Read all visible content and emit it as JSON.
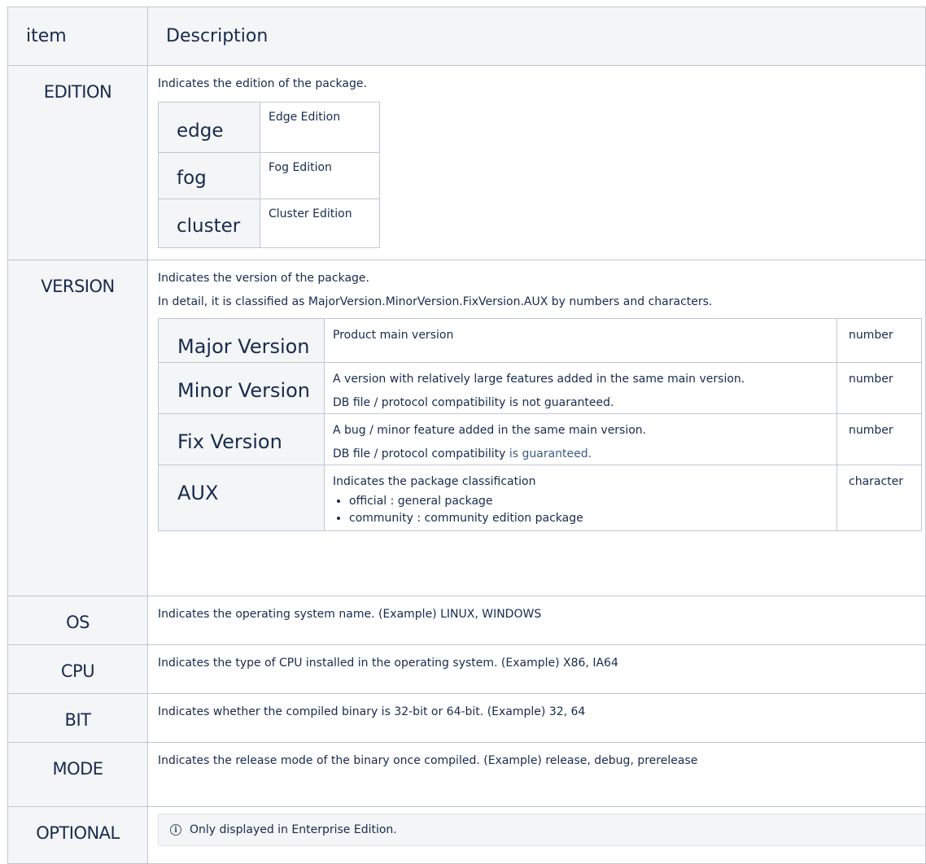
{
  "header": {
    "item": "item",
    "description": "Description"
  },
  "rows": {
    "edition": {
      "item": "EDITION",
      "desc": "Indicates the edition of the package.",
      "options": [
        {
          "name": "edge",
          "label": "Edge Edition"
        },
        {
          "name": "fog",
          "label": "Fog Edition"
        },
        {
          "name": "cluster",
          "label": "Cluster Edition"
        }
      ]
    },
    "version": {
      "item": "VERSION",
      "desc1": "Indicates the version of the package.",
      "desc2": "In detail, it is classified as MajorVersion.MinorVersion.FixVersion.AUX by numbers and characters.",
      "major": {
        "name": "Major Version",
        "desc": "Product main version",
        "type": "number"
      },
      "minor": {
        "name": "Minor Version",
        "desc1": "A version with relatively large features added in the same main version.",
        "desc2": "DB file / protocol compatibility is not guaranteed.",
        "type": "number"
      },
      "fix": {
        "name": "Fix Version",
        "desc1": "A bug / minor feature added in the same main version.",
        "desc2a": "DB file / protocol compatibility ",
        "desc2b": " is guaranteed.",
        "type": "number"
      },
      "aux": {
        "name": "AUX",
        "desc": "Indicates the package classification",
        "bullets": [
          "official : general package",
          "community : community edition package"
        ],
        "type": "character"
      }
    },
    "os": {
      "item": "OS",
      "desc": "Indicates the operating system name. (Example) LINUX, WINDOWS"
    },
    "cpu": {
      "item": "CPU",
      "desc": "Indicates the type of CPU installed in the operating system. (Example) X86, IA64"
    },
    "bit": {
      "item": "BIT",
      "desc": "Indicates whether  the compiled binary  is 32-bit or 64-bit. (Example) 32, 64"
    },
    "mode": {
      "item": "MODE",
      "desc": "Indicates the release mode of the binary once compiled. (Example) release, debug, prerelease"
    },
    "optional": {
      "item": "OPTIONAL",
      "info": "Only displayed in Enterprise Edition."
    }
  }
}
